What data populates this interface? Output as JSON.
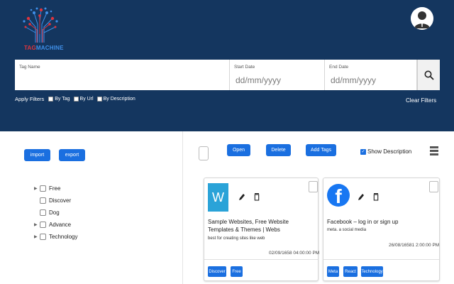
{
  "header": {
    "logo_text_part1": "TAG",
    "logo_text_part2": "MACHINE",
    "colors": {
      "background": "#14365f",
      "accent": "#1a6fe0",
      "logo_red": "#e0343c",
      "logo_blue": "#3f8fe8"
    }
  },
  "search": {
    "tag_name_label": "Tag Name",
    "tag_name_value": "",
    "start_date_label": "Start Date",
    "start_date_placeholder": "dd/mm/yyyy",
    "end_date_label": "End Date",
    "end_date_placeholder": "dd/mm/yyyy",
    "search_icon": "search-icon"
  },
  "filters": {
    "apply_label": "Apply Filters",
    "options": [
      "By Tag",
      "By Url",
      "By Description"
    ],
    "clear_label": "Clear Filters"
  },
  "left_panel": {
    "import_label": "import",
    "export_label": "export",
    "tree": [
      {
        "label": "Free",
        "expandable": true
      },
      {
        "label": "Discover",
        "expandable": false
      },
      {
        "label": "Dog",
        "expandable": false
      },
      {
        "label": "Advance",
        "expandable": true
      },
      {
        "label": "Technology",
        "expandable": true
      }
    ]
  },
  "toolbar": {
    "open_label": "Open",
    "delete_label": "Delete",
    "add_tags_label": "Add Tags",
    "show_description_label": "Show Description",
    "show_description_checked": true
  },
  "cards": [
    {
      "icon": "wordpress-icon",
      "icon_letter": "W",
      "title": "Sample Websites, Free Website Templates & Themes | Webs",
      "description": "best for creating sites like web",
      "date": "02/09/1658 04:00:00 PM",
      "tags": [
        "Discover",
        "Free"
      ]
    },
    {
      "icon": "facebook-icon",
      "icon_letter": "f",
      "title": "Facebook – log in or sign up",
      "description": "meta. a social media",
      "date": "26/08/16581 2:00:00 PM",
      "tags": [
        "Meta",
        "React",
        "Technology"
      ]
    }
  ]
}
